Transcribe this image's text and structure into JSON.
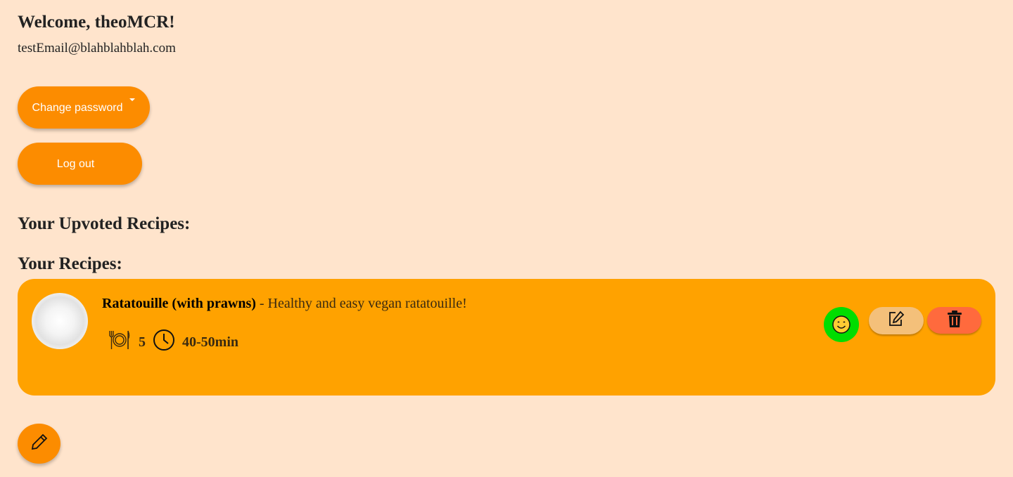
{
  "header": {
    "welcome": "Welcome, theoMCR!",
    "email": "testEmail@blahblahblah.com"
  },
  "buttons": {
    "change_password": "Change password",
    "log_out": "Log out"
  },
  "sections": {
    "upvoted_title": "Your Upvoted Recipes:",
    "recipes_title": "Your Recipes:"
  },
  "recipes": [
    {
      "name": "Ratatouille (with prawns)",
      "description": " - Healthy and easy vegan ratatouille!",
      "servings": "5",
      "time": "40-50min",
      "image_icon": "plate-icon",
      "mood_icon": "smiley-face-icon",
      "mood_color": "#00dd00"
    }
  ],
  "colors": {
    "background": "#ffe4cc",
    "primary": "#fc8c00",
    "card": "#ffa200",
    "edit": "#f4c07a",
    "delete": "#ff6a3d"
  },
  "icons": {
    "caret": "caret-down-icon",
    "servings": "plate-cutlery-icon",
    "time": "clock-icon",
    "edit": "edit-icon",
    "delete": "trash-icon",
    "create": "pencil-icon"
  }
}
